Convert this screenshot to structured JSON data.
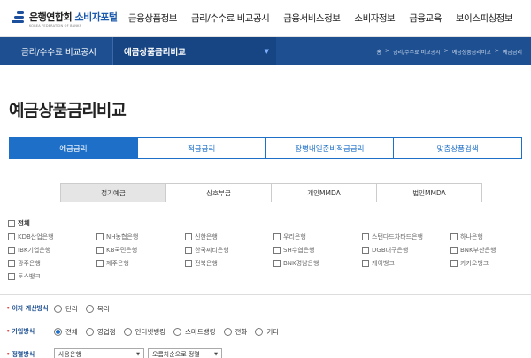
{
  "header": {
    "logo_main": "은행연합회",
    "logo_accent": "소비자포털",
    "logo_sub": "KOREA FEDERATION OF BANKS",
    "nav": [
      "금융상품정보",
      "금리/수수료 비교공시",
      "금융서비스정보",
      "소비자정보",
      "금융교육",
      "보이스피싱정보"
    ]
  },
  "locbar": {
    "level1": "금리/수수료 비교공시",
    "level2": "예금상품금리비교",
    "crumbs": [
      "홈",
      ">",
      "금리/수수료 비교공시",
      ">",
      "예금상품금리비교",
      ">",
      "예금금리"
    ]
  },
  "page_title": "예금상품금리비교",
  "tabs": [
    "예금금리",
    "적금금리",
    "장병내일준비적금금리",
    "맞춤상품검색"
  ],
  "subtabs": [
    "정기예금",
    "상호부금",
    "개인MMDA",
    "법인MMDA"
  ],
  "banks": {
    "all_label": "전체",
    "list": [
      "KDB산업은행",
      "NH농협은행",
      "신한은행",
      "우리은행",
      "스탠다드차타드은행",
      "하나은행",
      "IBK기업은행",
      "KB국민은행",
      "한국씨티은행",
      "SH수협은행",
      "DGB대구은행",
      "BNK부산은행",
      "광주은행",
      "제주은행",
      "전북은행",
      "BNK경남은행",
      "케이뱅크",
      "카카오뱅크",
      "토스뱅크"
    ]
  },
  "interest": {
    "label": "이자 계산방식",
    "options": [
      "단리",
      "복리"
    ]
  },
  "join": {
    "label": "가입방식",
    "options": [
      "전체",
      "영업점",
      "인터넷뱅킹",
      "스마트뱅킹",
      "전화",
      "기타"
    ],
    "selected": "전체"
  },
  "sort": {
    "label": "정렬방식",
    "select1": "사용은행",
    "select2": "오름차순으로 정렬"
  }
}
